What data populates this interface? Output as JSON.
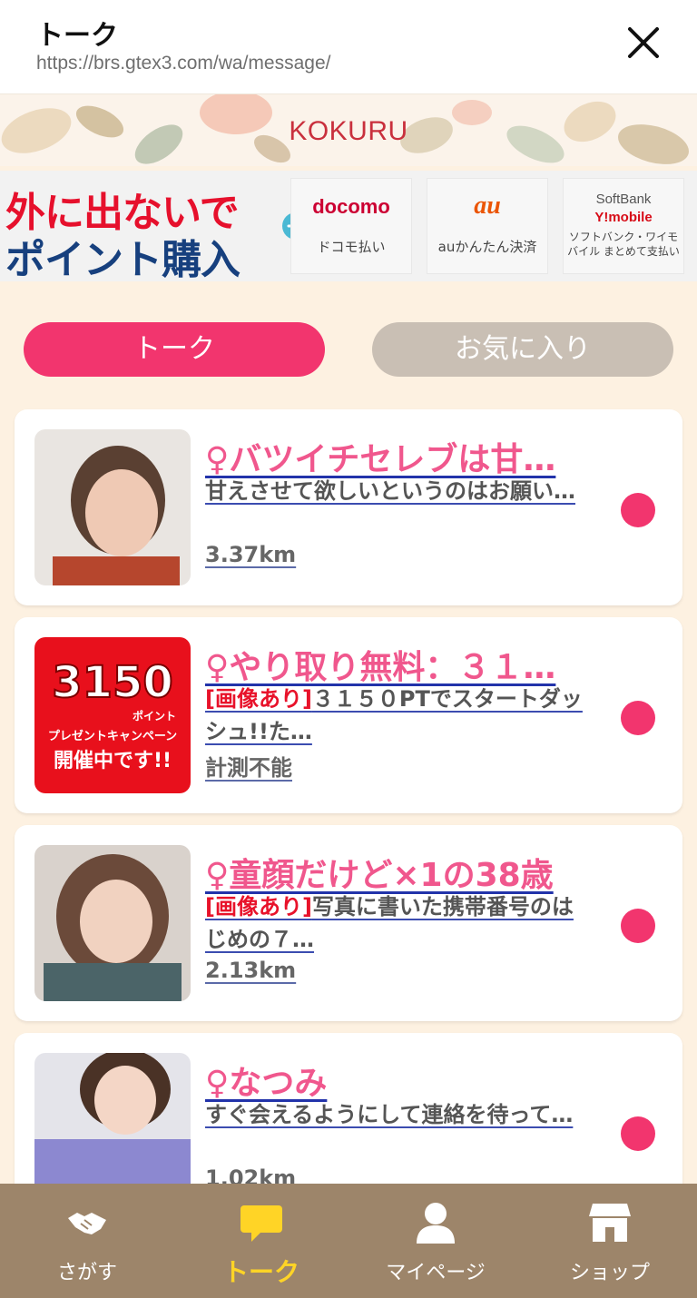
{
  "topbar": {
    "title": "トーク",
    "url": "https://brs.gtex3.com/wa/message/"
  },
  "banner": {
    "logo": "KOKURU"
  },
  "payment_banner": {
    "promo_line1": "外に出ないで",
    "promo_line2": "ポイント購入",
    "docomo": {
      "brand": "docomo",
      "caption": "ドコモ払い"
    },
    "au": {
      "brand": "au",
      "caption": "auかんたん決済"
    },
    "softbank": {
      "brand1": "SoftBank",
      "brand2": "Y!mobile",
      "caption": "ソフトバンク・ワイモバイル まとめて支払い"
    }
  },
  "tabs": {
    "talk": "トーク",
    "favorites": "お気に入り"
  },
  "conversations": [
    {
      "name": "♀バツイチセレブは甘…",
      "tag": "",
      "message": "甘えさせて欲しいというのはお願い…",
      "distance": "3.37km"
    },
    {
      "name": "♀やり取り無料：３１…",
      "tag": "[画像あり]",
      "message": "３１５０PTでスタートダッシュ!!た…",
      "distance": "計測不能",
      "thumb_text": {
        "big": "3150",
        "small1": "ポイント",
        "small2": "プレゼントキャンペーン",
        "small3": "開催中です!!"
      }
    },
    {
      "name": "♀童顔だけど×1の38歳",
      "tag": "[画像あり]",
      "message": "写真に書いた携帯番号のはじめの７…",
      "distance": "2.13km"
    },
    {
      "name": "♀なつみ",
      "tag": "",
      "message": "すぐ会えるようにして連絡を待って…",
      "distance": "1.02km"
    }
  ],
  "bottom_nav": {
    "search": "さがす",
    "talk": "トーク",
    "mypage": "マイページ",
    "shop": "ショップ"
  },
  "colors": {
    "accent_pink": "#f2356e",
    "background": "#fdf1e1",
    "nav_brown": "#9d856a",
    "active_yellow": "#ffd426"
  }
}
